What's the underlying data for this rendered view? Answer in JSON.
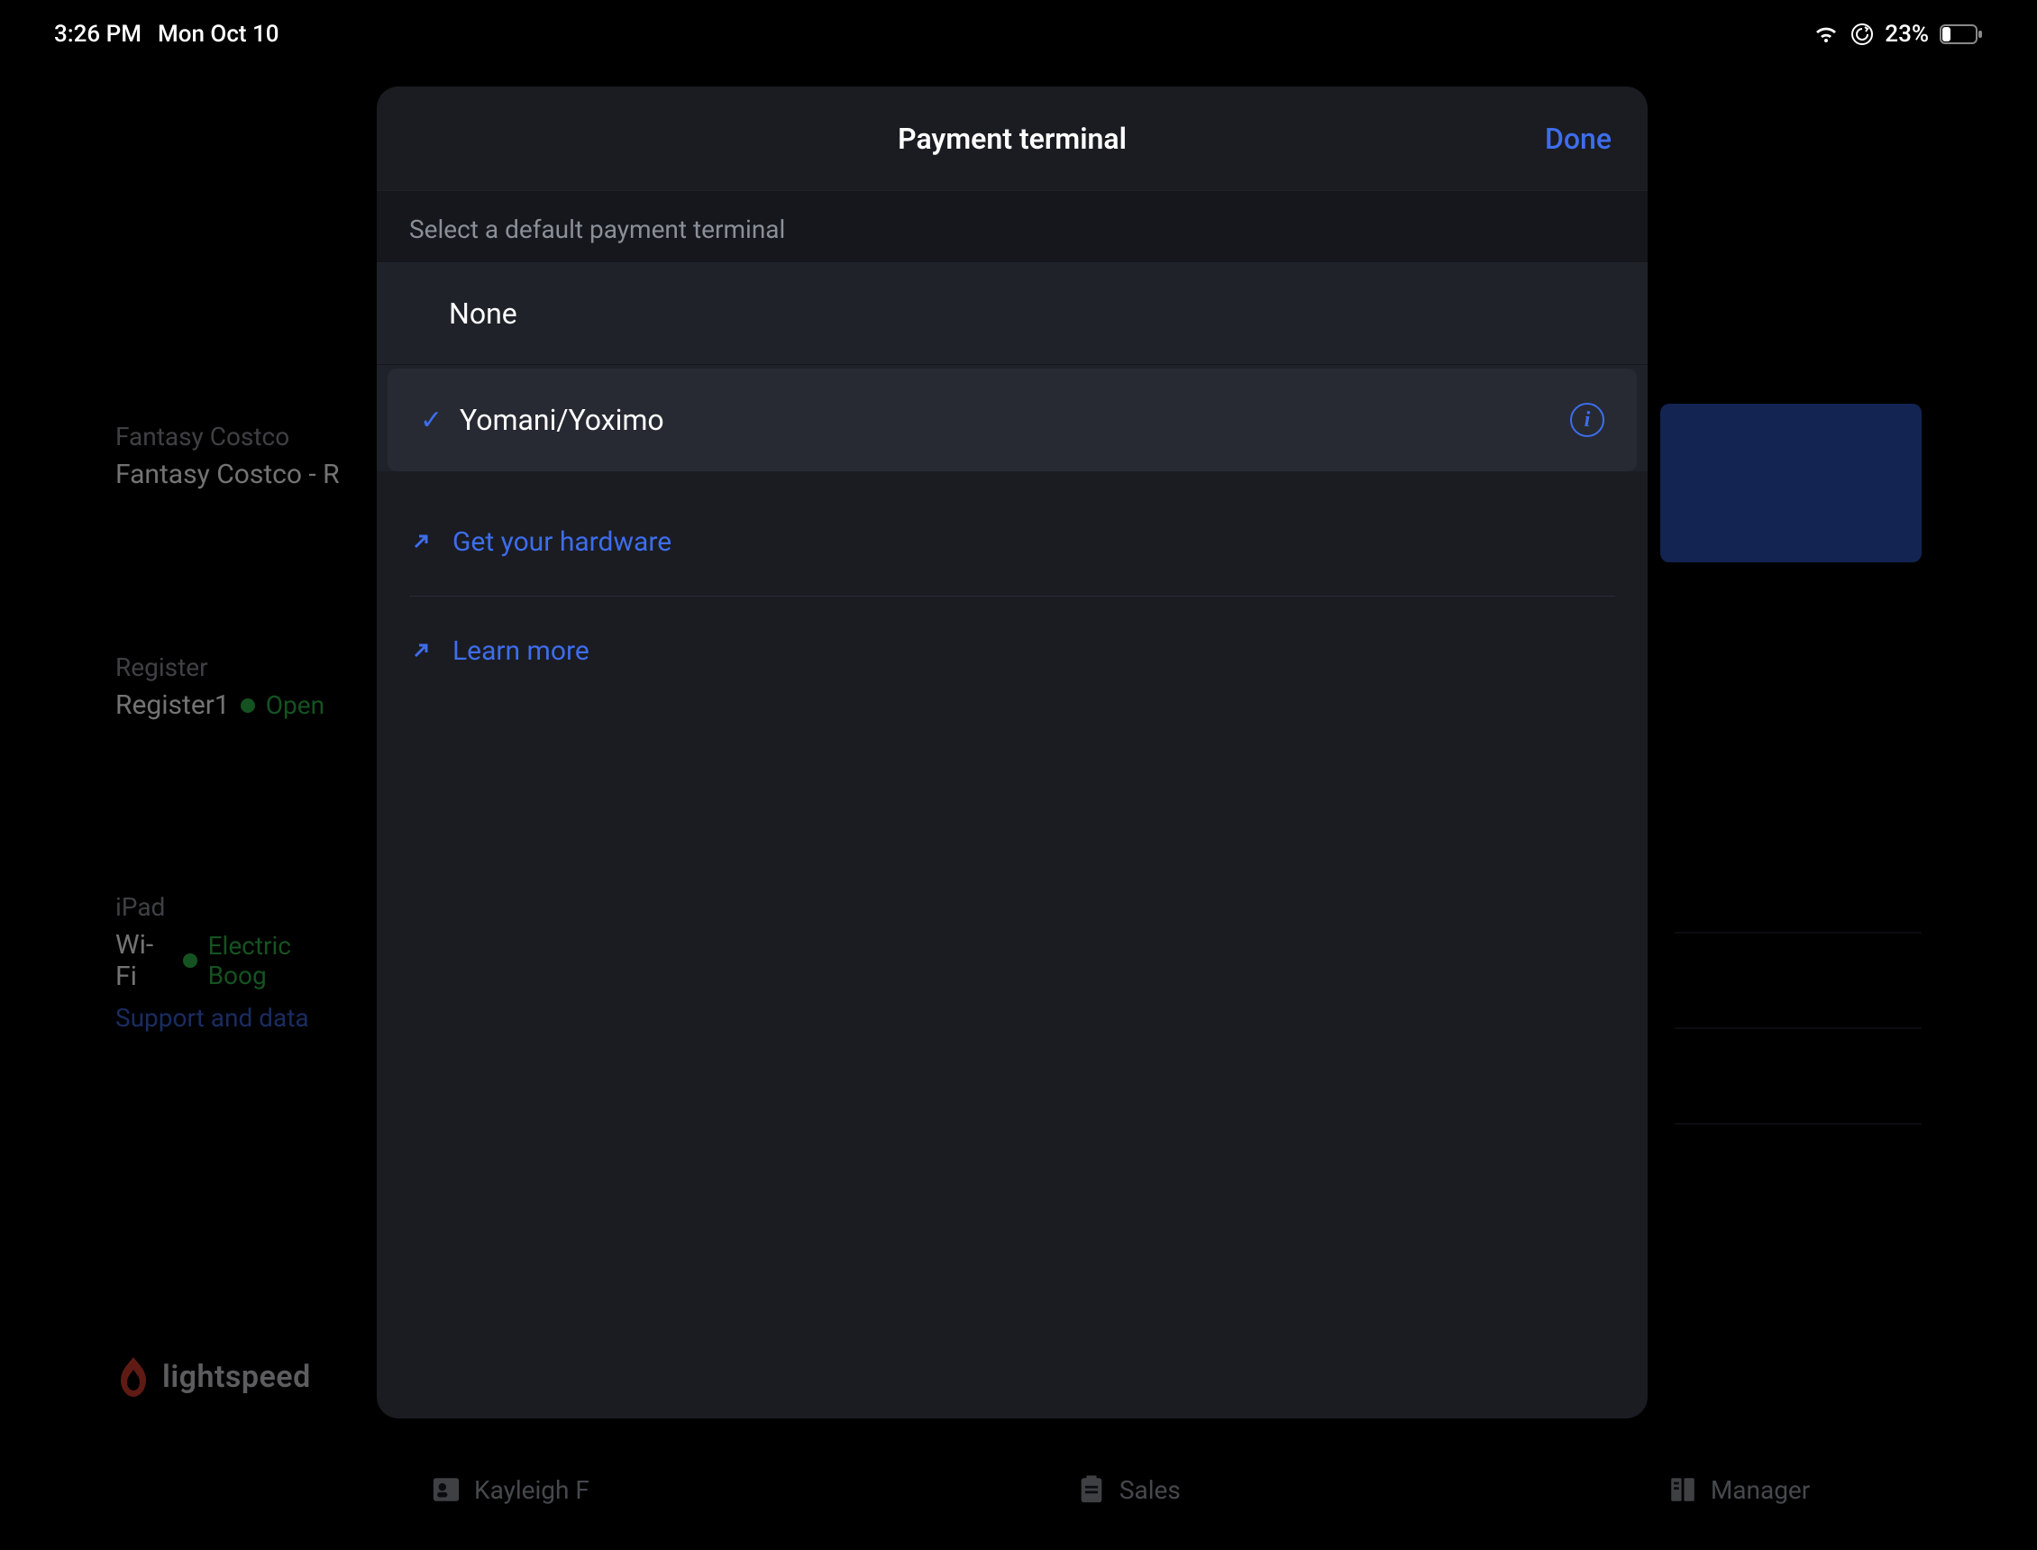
{
  "status": {
    "time": "3:26 PM",
    "date": "Mon Oct 10",
    "battery": "23%"
  },
  "sidebar": {
    "store_label": "Fantasy Costco",
    "store_value": "Fantasy Costco - R",
    "register_label": "Register",
    "register_value": "Register1",
    "register_status": "Open",
    "ipad_label": "iPad",
    "wifi_label": "Wi-Fi",
    "wifi_name": "Electric Boog",
    "support_link": "Support and data",
    "brand": "lightspeed"
  },
  "modal": {
    "title": "Payment terminal",
    "done": "Done",
    "section_header": "Select a default payment terminal",
    "options": [
      {
        "label": "None",
        "selected": false,
        "info": false
      },
      {
        "label": "Yomani/Yoximo",
        "selected": true,
        "info": true
      }
    ],
    "links": [
      {
        "label": "Get your hardware"
      },
      {
        "label": "Learn more"
      }
    ]
  },
  "bottombar": {
    "user": "Kayleigh F",
    "sales": "Sales",
    "manager": "Manager"
  }
}
